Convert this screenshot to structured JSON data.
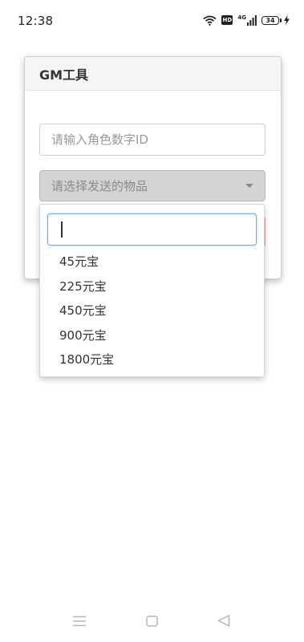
{
  "status_bar": {
    "time": "12:38",
    "network_label": "4G",
    "battery_level": "34",
    "icons": [
      "wifi-icon",
      "hd-icon",
      "signal-icon",
      "battery-icon",
      "charging-icon"
    ]
  },
  "dialog": {
    "title": "GM工具",
    "role_id_input": {
      "value": "",
      "placeholder": "请输入角色数字ID"
    },
    "item_select": {
      "placeholder": "请选择发送的物品"
    }
  },
  "dropdown": {
    "search_value": "",
    "options": [
      "45元宝",
      "225元宝",
      "450元宝",
      "900元宝",
      "1800元宝"
    ]
  },
  "nav_bar": {
    "icons": [
      "menu-icon",
      "home-icon",
      "back-icon"
    ]
  },
  "colors": {
    "focus_blue": "#6aaee6",
    "select_bg": "#d4d4d4",
    "danger_border": "#e2a3a3"
  }
}
